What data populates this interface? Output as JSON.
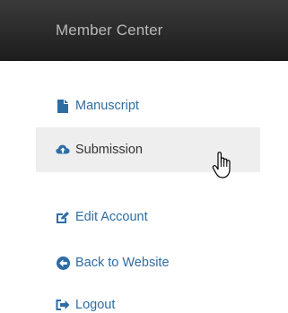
{
  "header": {
    "title": "Member Center"
  },
  "menu": {
    "items": [
      {
        "label": "Manuscript",
        "icon": "file-icon",
        "active": false
      },
      {
        "label": "Submission",
        "icon": "cloud-upload-icon",
        "active": true
      },
      {
        "label": "Edit Account",
        "icon": "edit-icon",
        "active": false
      },
      {
        "label": "Back to Website",
        "icon": "arrow-circle-left-icon",
        "active": false
      },
      {
        "label": "Logout",
        "icon": "sign-out-icon",
        "active": false
      }
    ]
  },
  "colors": {
    "header_bg": "#2a2a2a",
    "header_text": "#b9b9b9",
    "link": "#2e6da4",
    "active_bg": "#eeeeee",
    "active_text": "#333333"
  }
}
